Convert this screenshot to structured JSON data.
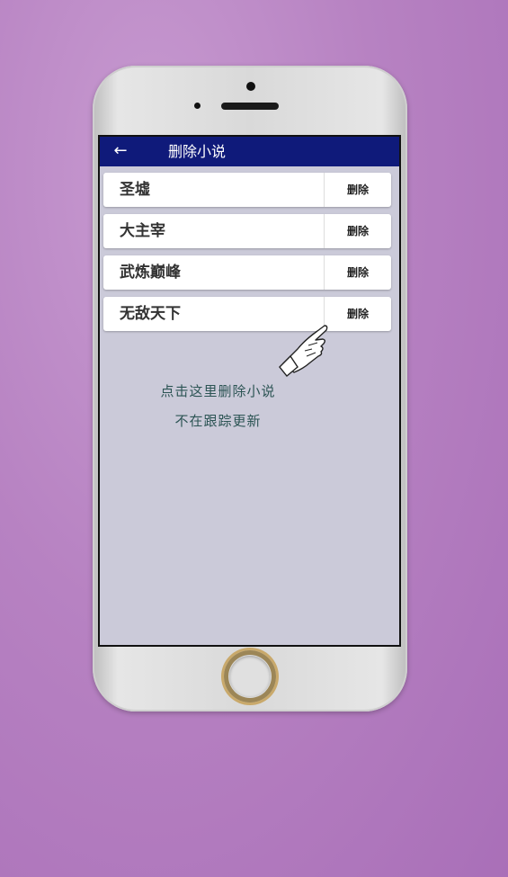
{
  "appbar": {
    "title": "删除小说",
    "back_icon": "arrow-left-icon"
  },
  "novels": [
    {
      "title": "圣墟",
      "delete_label": "删除"
    },
    {
      "title": "大主宰",
      "delete_label": "删除"
    },
    {
      "title": "武炼巅峰",
      "delete_label": "删除"
    },
    {
      "title": "无敌天下",
      "delete_label": "删除"
    }
  ],
  "hint": {
    "line1": "点击这里删除小说",
    "line2": "不在跟踪更新"
  },
  "colors": {
    "appbar": "#0f1a7a",
    "screen_bg": "#cbcad9",
    "hint_text": "#2c5454",
    "background": "#b782c2"
  }
}
